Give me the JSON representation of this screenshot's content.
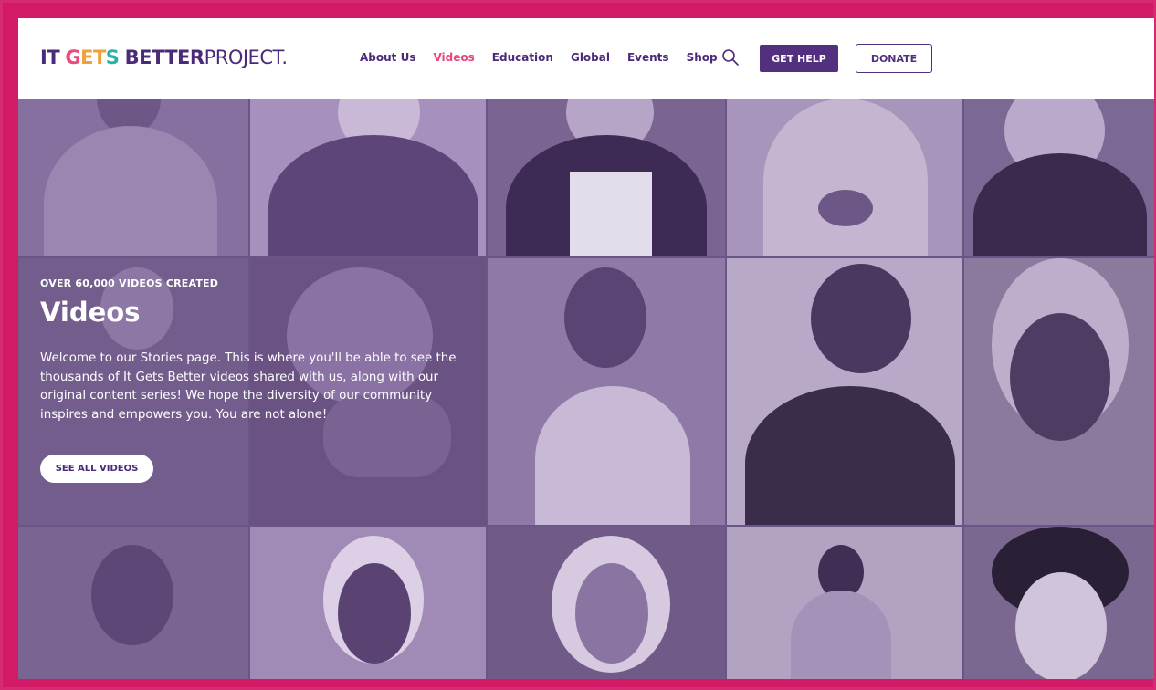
{
  "header": {
    "logo": {
      "word1": "IT",
      "word2": "GETS",
      "word3": "BETTER",
      "word4": "PROJECT."
    },
    "nav": [
      {
        "label": "About Us",
        "active": false
      },
      {
        "label": "Videos",
        "active": true
      },
      {
        "label": "Education",
        "active": false
      },
      {
        "label": "Global",
        "active": false
      },
      {
        "label": "Events",
        "active": false
      },
      {
        "label": "Shop",
        "active": false
      }
    ],
    "get_help": "GET HELP",
    "donate": "DONATE"
  },
  "hero": {
    "eyebrow": "OVER 60,000 VIDEOS CREATED",
    "title": "Videos",
    "description": "Welcome to our Stories page. This is where you'll be able to see the thousands of It Gets Better videos shared with us, along with our original content series! We hope the diversity of our community inspires and empowers you. You are not alone!",
    "cta": "SEE ALL VIDEOS"
  },
  "colors": {
    "brand_purple": "#52307f",
    "active_pink": "#e8467a",
    "frame_pink": "#d31a66",
    "overlay_purple": "#6b5486"
  }
}
